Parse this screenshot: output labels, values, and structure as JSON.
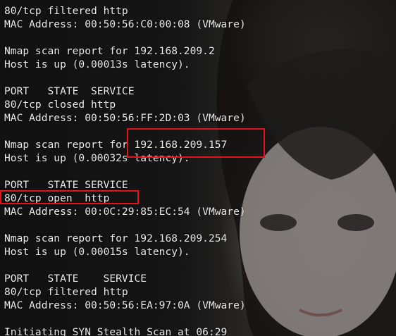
{
  "terminal": {
    "lines": [
      "80/tcp filtered http",
      "MAC Address: 00:50:56:C0:00:08 (VMware)",
      "",
      "Nmap scan report for 192.168.209.2",
      "Host is up (0.00013s latency).",
      "",
      "PORT   STATE  SERVICE",
      "80/tcp closed http",
      "MAC Address: 00:50:56:FF:2D:03 (VMware)",
      "",
      "Nmap scan report for 192.168.209.157",
      "Host is up (0.00032s latency).",
      "",
      "PORT   STATE SERVICE",
      "80/tcp open  http",
      "MAC Address: 00:0C:29:85:EC:54 (VMware)",
      "",
      "Nmap scan report for 192.168.209.254",
      "Host is up (0.00015s latency).",
      "",
      "PORT   STATE    SERVICE",
      "80/tcp filtered http",
      "MAC Address: 00:50:56:EA:97:0A (VMware)",
      "",
      "Initiating SYN Stealth Scan at 06:29"
    ]
  },
  "colors": {
    "text": "#e8e8e8",
    "highlight_box": "#e0151b"
  }
}
